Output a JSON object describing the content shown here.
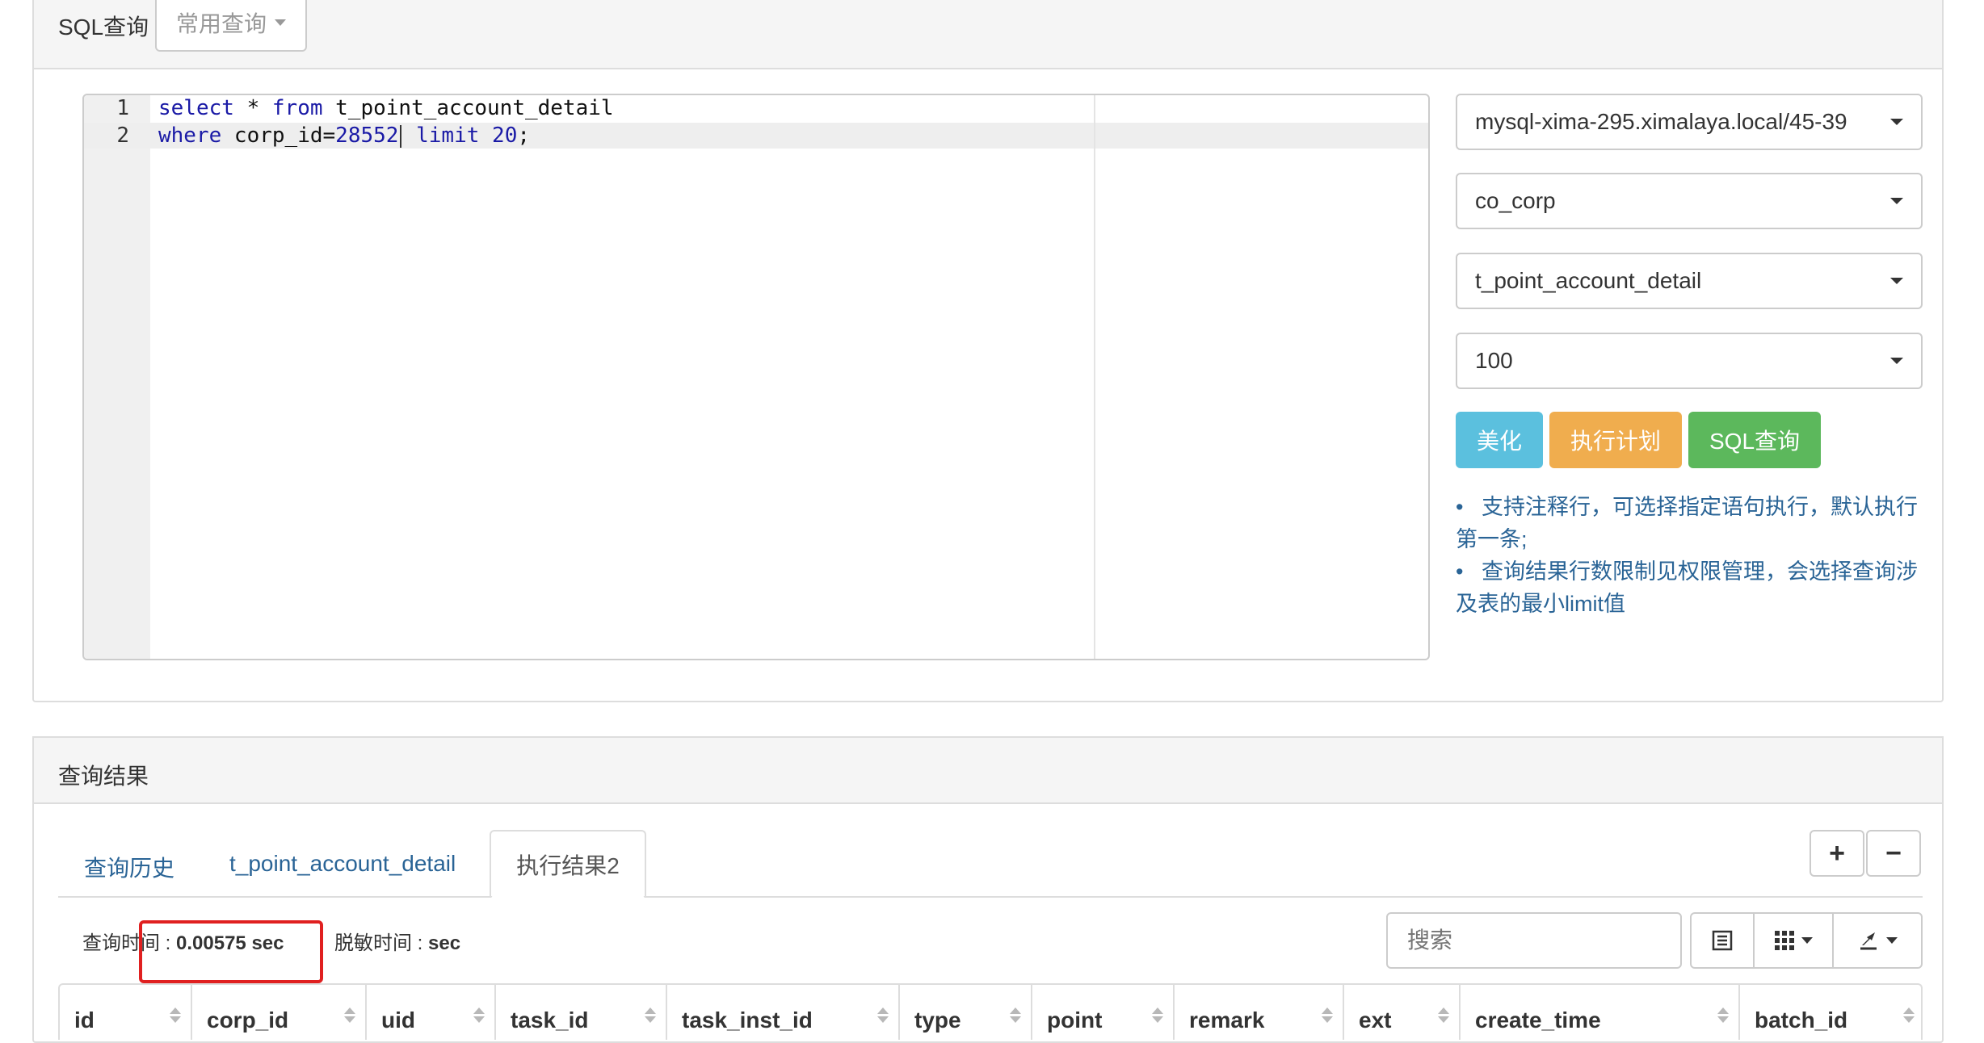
{
  "query_panel": {
    "title": "SQL查询",
    "common_query_label": "常用查询",
    "editor": {
      "line_numbers": [
        "1",
        "2"
      ],
      "lines": [
        {
          "tokens": [
            {
              "t": "select",
              "k": "kw"
            },
            {
              "t": " * ",
              "k": ""
            },
            {
              "t": "from",
              "k": "kw"
            },
            {
              "t": " t_point_account_detail",
              "k": ""
            }
          ]
        },
        {
          "tokens": [
            {
              "t": "where",
              "k": "kw"
            },
            {
              "t": " corp_id=",
              "k": ""
            },
            {
              "t": "28552",
              "k": "num2"
            },
            {
              "t": "|",
              "k": "cursor"
            },
            {
              "t": " ",
              "k": ""
            },
            {
              "t": "limit",
              "k": "kw"
            },
            {
              "t": " ",
              "k": ""
            },
            {
              "t": "20",
              "k": "num2"
            },
            {
              "t": ";",
              "k": ""
            }
          ]
        }
      ]
    },
    "instance_select": "mysql-xima-295.ximalaya.local/45-39",
    "database_select": "co_corp",
    "table_select": "t_point_account_detail",
    "limit_select": "100",
    "buttons": {
      "beautify": "美化",
      "explain": "执行计划",
      "query": "SQL查询"
    },
    "button_colors": {
      "beautify": "#5bc0de",
      "explain": "#f0ad4e",
      "query": "#5cb85c"
    },
    "tips": [
      "支持注释行，可选择指定语句执行，默认执行第一条;",
      "查询结果行数限制见权限管理，会选择查询涉及表的最小limit值"
    ]
  },
  "result_panel": {
    "title": "查询结果",
    "tabs": [
      "查询历史",
      "t_point_account_detail",
      "执行结果2"
    ],
    "add_label": "+",
    "remove_label": "−",
    "query_time_label": "查询时间 : ",
    "query_time_value": "0.00575 sec",
    "mask_time_label": "脱敏时间 : ",
    "mask_time_value": "sec",
    "search_placeholder": "搜索",
    "toolbar_icons": [
      "list-icon",
      "columns-grid-icon",
      "export-icon"
    ],
    "columns": [
      "id",
      "corp_id",
      "uid",
      "task_id",
      "task_inst_id",
      "type",
      "point",
      "remark",
      "ext",
      "create_time",
      "batch_id"
    ]
  }
}
